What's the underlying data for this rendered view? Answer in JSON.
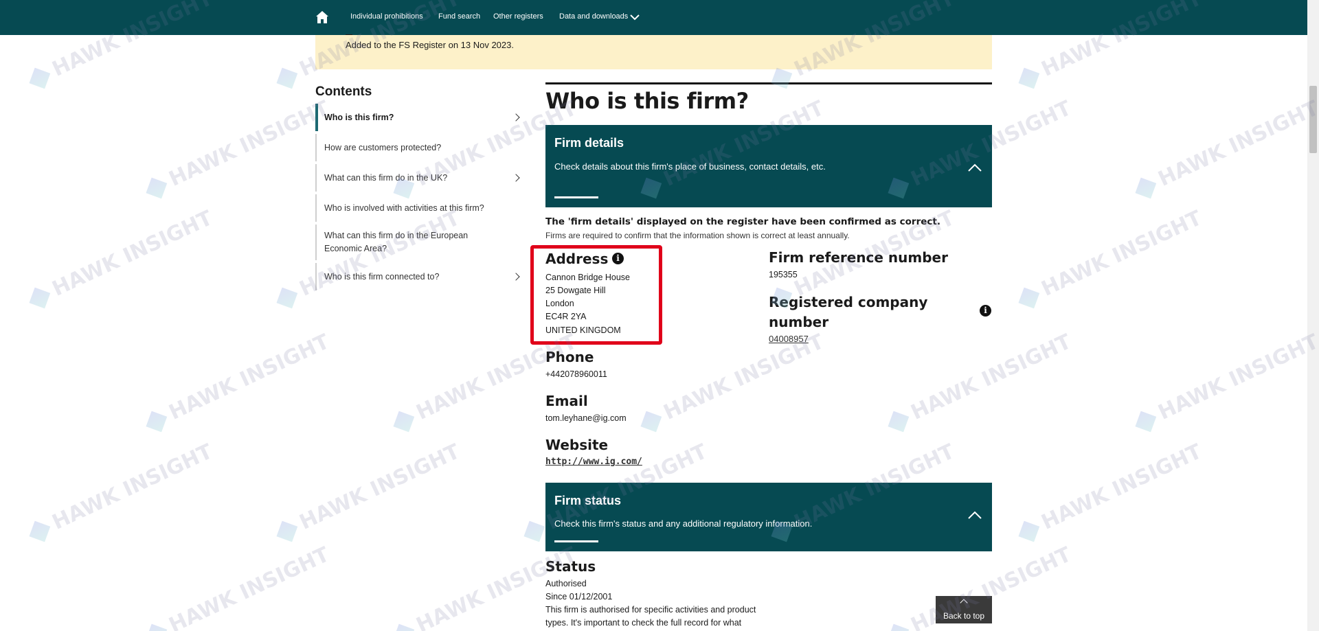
{
  "nav": {
    "items": [
      "Individual prohibitions",
      "Fund search",
      "Other registers",
      "Data and downloads"
    ]
  },
  "banner": {
    "text": "Added to the FS Register on 13 Nov 2023."
  },
  "contents": {
    "title": "Contents",
    "items": [
      {
        "label": "Who is this firm?",
        "active": true,
        "chevron": true
      },
      {
        "label": "How are customers protected?",
        "active": false,
        "chevron": false
      },
      {
        "label": "What can this firm do in the UK?",
        "active": false,
        "chevron": true
      },
      {
        "label": "Who is involved with activities at this firm?",
        "active": false,
        "chevron": false
      },
      {
        "label": "What can this firm do in the European Economic Area?",
        "active": false,
        "chevron": false
      },
      {
        "label": "Who is this firm connected to?",
        "active": false,
        "chevron": true
      }
    ]
  },
  "main": {
    "title": "Who is this firm?",
    "firm_details": {
      "title": "Firm details",
      "desc": "Check details about this firm's place of business, contact details, etc."
    },
    "confirmed_bold": "The 'firm details' displayed on the register have been confirmed as correct.",
    "confirmed_sub": "Firms are required to confirm that the information shown is correct at least annually.",
    "address": {
      "heading": "Address",
      "lines": [
        "Cannon Bridge House",
        "25 Dowgate Hill",
        "London",
        "EC4R 2YA",
        "UNITED KINGDOM"
      ]
    },
    "frn": {
      "heading": "Firm reference number",
      "value": "195355"
    },
    "company_number": {
      "heading": "Registered company number",
      "value": "04008957"
    },
    "phone": {
      "heading": "Phone",
      "value": "+442078960011"
    },
    "email": {
      "heading": "Email",
      "value": "tom.leyhane@ig.com"
    },
    "website": {
      "heading": "Website",
      "value": "http://www.ig.com/"
    },
    "firm_status": {
      "title": "Firm status",
      "desc": "Check this firm's status and any additional regulatory information."
    },
    "status": {
      "heading": "Status",
      "value": "Authorised",
      "since": "Since 01/12/2001",
      "note": "This firm is authorised for specific activities and product types. It's important to check the full record for what"
    }
  },
  "back_to_top": "Back to top",
  "watermark": "HAWK INSIGHT",
  "colors": {
    "nav": "#064a52",
    "banner": "#fdf1c9",
    "highlight": "#e0001a"
  }
}
